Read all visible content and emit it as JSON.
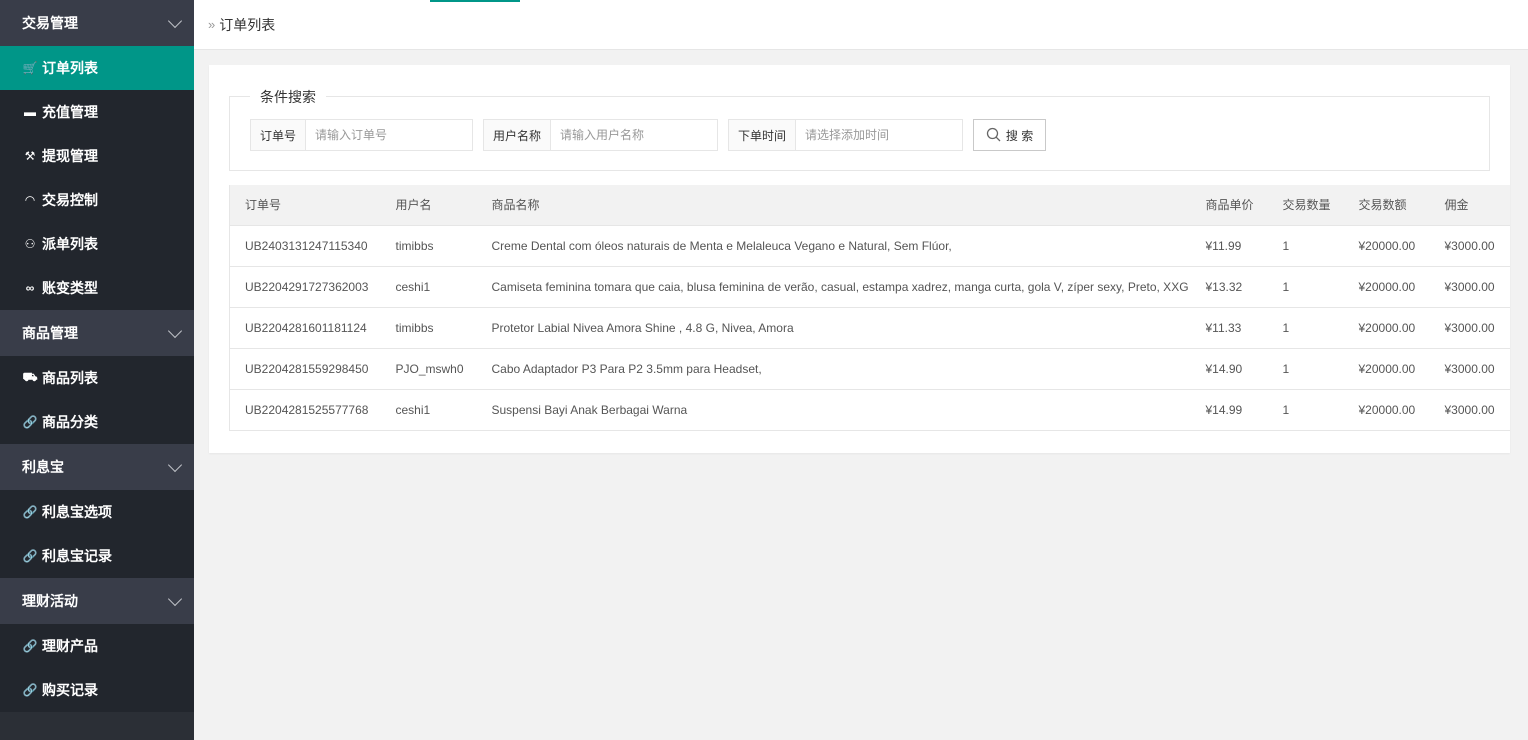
{
  "sidebar": {
    "groups": [
      {
        "label": "交易管理",
        "items": [
          {
            "icon": "cart-icon",
            "glyph": "🛒",
            "label": "订单列表",
            "active": true
          },
          {
            "icon": "card-icon",
            "glyph": "▬",
            "label": "充值管理"
          },
          {
            "icon": "hammer-icon",
            "glyph": "⚒",
            "label": "提现管理"
          },
          {
            "icon": "gauge-icon",
            "glyph": "◠",
            "label": "交易控制"
          },
          {
            "icon": "group-icon",
            "glyph": "⚇",
            "label": "派单列表"
          },
          {
            "icon": "infinity-icon",
            "glyph": "∞",
            "label": "账变类型"
          }
        ]
      },
      {
        "label": "商品管理",
        "items": [
          {
            "icon": "cart-icon",
            "glyph": "⛟",
            "label": "商品列表"
          },
          {
            "icon": "link-icon",
            "glyph": "🔗",
            "label": "商品分类"
          }
        ]
      },
      {
        "label": "利息宝",
        "items": [
          {
            "icon": "link-icon",
            "glyph": "🔗",
            "label": "利息宝选项"
          },
          {
            "icon": "link-icon",
            "glyph": "🔗",
            "label": "利息宝记录"
          }
        ]
      },
      {
        "label": "理财活动",
        "items": [
          {
            "icon": "link-icon",
            "glyph": "🔗",
            "label": "理财产品"
          },
          {
            "icon": "link-icon",
            "glyph": "🔗",
            "label": "购买记录"
          }
        ]
      }
    ]
  },
  "header": {
    "breadcrumb_sep": "»",
    "title": "订单列表"
  },
  "search": {
    "legend": "条件搜索",
    "order_no": {
      "label": "订单号",
      "placeholder": "请输入订单号",
      "value": ""
    },
    "username": {
      "label": "用户名称",
      "placeholder": "请输入用户名称",
      "value": ""
    },
    "order_time": {
      "label": "下单时间",
      "placeholder": "请选择添加时间",
      "value": ""
    },
    "button_label": "搜 索"
  },
  "table": {
    "columns": [
      "订单号",
      "用户名",
      "商品名称",
      "商品单价",
      "交易数量",
      "交易数额",
      "佣金",
      ""
    ],
    "rows": [
      [
        "UB2403131247115340",
        "timibbs",
        "Creme Dental com óleos naturais de Menta e Melaleuca Vegano e Natural, Sem Flúor,",
        "¥11.99",
        "1",
        "¥20000.00",
        "¥3000.00",
        ":"
      ],
      [
        "UB2204291727362003",
        "ceshi1",
        "Camiseta feminina tomara que caia, blusa feminina de verão, casual, estampa xadrez, manga curta, gola V, zíper sexy, Preto, XXG",
        "¥13.32",
        "1",
        "¥20000.00",
        "¥3000.00",
        ":"
      ],
      [
        "UB2204281601181124",
        "timibbs",
        "Protetor Labial Nivea Amora Shine , 4.8 G, Nivea, Amora",
        "¥11.33",
        "1",
        "¥20000.00",
        "¥3000.00",
        ":"
      ],
      [
        "UB2204281559298450",
        "PJO_mswh0",
        "Cabo Adaptador P3 Para P2 3.5mm para Headset,",
        "¥14.90",
        "1",
        "¥20000.00",
        "¥3000.00",
        ":"
      ],
      [
        "UB2204281525577768",
        "ceshi1",
        "Suspensi Bayi Anak Berbagai Warna",
        "¥14.99",
        "1",
        "¥20000.00",
        "¥3000.00",
        ":"
      ]
    ]
  },
  "colors": {
    "accent": "#009688",
    "sidebar_bg": "#22262d",
    "group_bg": "#393d49"
  }
}
